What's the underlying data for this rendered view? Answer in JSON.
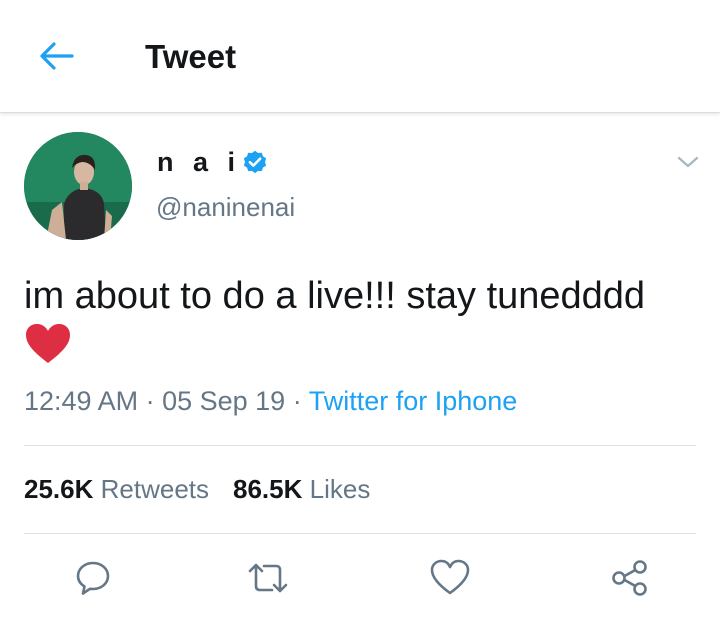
{
  "header": {
    "title": "Tweet",
    "back_icon": "back-arrow-icon"
  },
  "tweet": {
    "author": {
      "name": "n a i",
      "handle": "@naninenai",
      "verified": true
    },
    "text": "im about to do a live!!! stay tunedddd",
    "emoji": "red-heart",
    "time": "12:49 AM",
    "date": "05 Sep 19",
    "separator": " · ",
    "source": "Twitter for Iphone",
    "stats": {
      "retweets_count": "25.6K",
      "retweets_label": "Retweets",
      "likes_count": "86.5K",
      "likes_label": "Likes"
    }
  },
  "actions": [
    "reply-icon",
    "retweet-icon",
    "like-icon",
    "share-icon"
  ],
  "colors": {
    "accent": "#1da1f2",
    "secondary_text": "#657786",
    "verified": "#1da1f2",
    "heart": "#dd2e44"
  }
}
